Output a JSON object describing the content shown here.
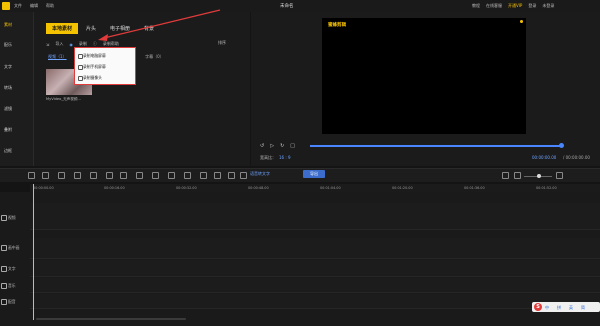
{
  "app": {
    "title": "未命名",
    "menu": [
      "文件",
      "编辑",
      "帮助"
    ],
    "right_menu": [
      "教程",
      "在线客服",
      "开通VIP",
      "登录"
    ],
    "vip_label": "开通VIP",
    "user_label": "未登录",
    "brand": "蜜蜂剪辑"
  },
  "sidebar": {
    "items": [
      {
        "label": "素材",
        "active": true
      },
      {
        "label": "配乐",
        "active": false
      },
      {
        "label": "文字",
        "active": false
      },
      {
        "label": "转场",
        "active": false
      },
      {
        "label": "滤镜",
        "active": false
      },
      {
        "label": "叠附",
        "active": false
      },
      {
        "label": "边框",
        "active": false
      }
    ]
  },
  "media": {
    "tabs": [
      {
        "label": "本地素材",
        "active": true
      },
      {
        "label": "片头",
        "active": false
      },
      {
        "label": "电子相册",
        "active": false
      },
      {
        "label": "背景",
        "active": false
      }
    ],
    "toolbar": {
      "import_label": "导入",
      "record_label": "录制",
      "record_help": "录制帮助",
      "sort_label": "排序"
    },
    "subtabs": [
      {
        "label": "视频（1）",
        "active": true
      },
      {
        "label": "音频（0）",
        "active": false
      },
      {
        "label": "字幕（0）",
        "active": false
      }
    ],
    "dropdown": {
      "items": [
        "录制电脑屏幕",
        "录制手机屏幕",
        "录制摄像头"
      ]
    },
    "thumbnail_label": "MyVideo_无声视频..."
  },
  "preview": {
    "ratio_label": "宽高比：",
    "ratio_value": "16 : 9",
    "current_time": "00:00:00.00",
    "total_time": "/ 00:00:00.00",
    "progress_fraction": 0.0
  },
  "timeline": {
    "toolbar_action": "语音转文字",
    "export_label": "导出",
    "ticks": [
      "00:00:00.00",
      "00:00:16.00",
      "00:00:32.00",
      "00:00:48.00",
      "00:01:04.00",
      "00:01:20.00",
      "00:01:36.00",
      "00:01:52.00"
    ],
    "tracks": [
      {
        "label": "视频",
        "icon": "video-icon"
      },
      {
        "label": "画中画",
        "icon": "pip-icon"
      },
      {
        "label": "文字",
        "icon": "text-icon"
      },
      {
        "label": "音乐",
        "icon": "music-icon"
      },
      {
        "label": "配音",
        "icon": "mic-icon"
      }
    ]
  },
  "taskbar": {
    "logo": "S",
    "items": [
      "中",
      "拼",
      "英",
      "简"
    ]
  },
  "colors": {
    "accent": "#f5c200",
    "link": "#6fa3ff",
    "annotation": "#e23b3b"
  }
}
